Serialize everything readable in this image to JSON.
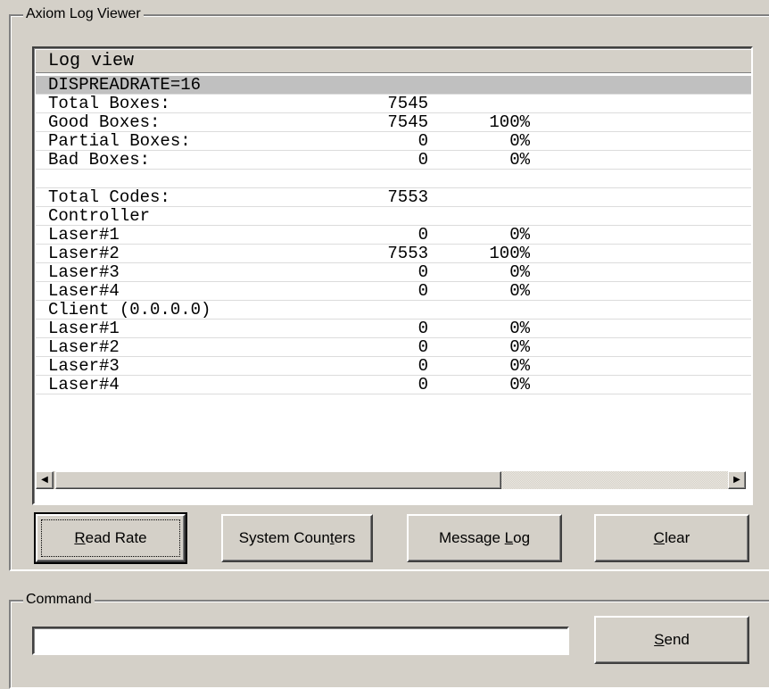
{
  "log_viewer": {
    "group_title": "Axiom Log Viewer",
    "list_header": "Log view",
    "rows": [
      {
        "c0": "DISPREADRATE=16",
        "c1": "",
        "c2": "",
        "selected": true
      },
      {
        "c0": "Total Boxes:",
        "c1": "7545",
        "c2": ""
      },
      {
        "c0": "Good Boxes:",
        "c1": "7545",
        "c2": "100%"
      },
      {
        "c0": "Partial Boxes:",
        "c1": "0",
        "c2": "0%"
      },
      {
        "c0": "Bad Boxes:",
        "c1": "0",
        "c2": "0%"
      },
      {
        "c0": "",
        "c1": "",
        "c2": ""
      },
      {
        "c0": "Total Codes:",
        "c1": "7553",
        "c2": ""
      },
      {
        "c0": "Controller",
        "c1": "",
        "c2": ""
      },
      {
        "c0": "Laser#1",
        "c1": "0",
        "c2": "0%"
      },
      {
        "c0": "Laser#2",
        "c1": "7553",
        "c2": "100%"
      },
      {
        "c0": "Laser#3",
        "c1": "0",
        "c2": "0%"
      },
      {
        "c0": "Laser#4",
        "c1": "0",
        "c2": "0%"
      },
      {
        "c0": "Client (0.0.0.0)",
        "c1": "",
        "c2": ""
      },
      {
        "c0": "Laser#1",
        "c1": "0",
        "c2": "0%"
      },
      {
        "c0": "Laser#2",
        "c1": "0",
        "c2": "0%"
      },
      {
        "c0": "Laser#3",
        "c1": "0",
        "c2": "0%"
      },
      {
        "c0": "Laser#4",
        "c1": "0",
        "c2": "0%"
      }
    ],
    "scroll_left_icon": "scroll-left-arrow",
    "scroll_right_icon": "scroll-right-arrow",
    "buttons": {
      "read_rate": {
        "mnemonic": "R",
        "rest": "ead Rate"
      },
      "system_counters": {
        "before": "System Coun",
        "mnemonic": "t",
        "after": "ers"
      },
      "message_log": {
        "before": "Message ",
        "mnemonic": "L",
        "after": "og"
      },
      "clear": {
        "mnemonic": "C",
        "rest": "lear"
      }
    }
  },
  "command": {
    "group_title": "Command",
    "input_value": "",
    "send": {
      "mnemonic": "S",
      "rest": "end"
    }
  },
  "colors": {
    "window_bg": "#d4d0c8",
    "list_bg": "#ffffff",
    "selected_row_bg": "#c0c0c0"
  }
}
